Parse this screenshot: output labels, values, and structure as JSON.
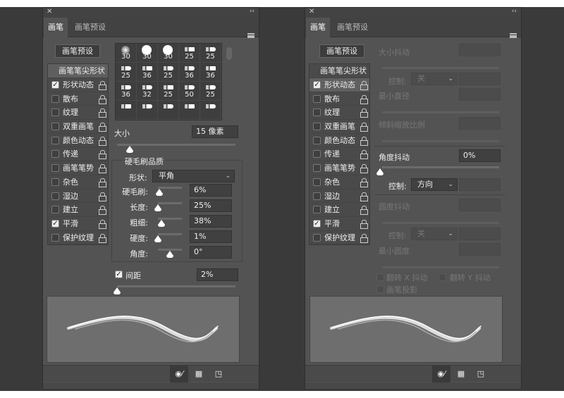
{
  "tabs": [
    "画笔",
    "画笔预设"
  ],
  "preset_button": "画笔预设",
  "list": {
    "header": "画笔笔尖形状",
    "items": [
      {
        "label": "形状动态",
        "checked": true
      },
      {
        "label": "散布",
        "checked": false
      },
      {
        "label": "纹理",
        "checked": false
      },
      {
        "label": "双重画笔",
        "checked": false
      },
      {
        "label": "颜色动态",
        "checked": false
      },
      {
        "label": "传递",
        "checked": false
      },
      {
        "label": "画笔笔势",
        "checked": false
      },
      {
        "label": "杂色",
        "checked": false
      },
      {
        "label": "湿边",
        "checked": false
      },
      {
        "label": "建立",
        "checked": false
      },
      {
        "label": "平滑",
        "checked": true
      },
      {
        "label": "保护纹理",
        "checked": false
      }
    ]
  },
  "brush_grid": {
    "sizes": [
      "30",
      "30",
      "30",
      "25",
      "25",
      "25",
      "36",
      "25",
      "36",
      "36",
      "36",
      "32",
      "25",
      "50",
      "25",
      "",
      "",
      "",
      "",
      ""
    ]
  },
  "left": {
    "size_label": "大小",
    "size_value": "15 像素",
    "size_slider": 0.1,
    "group_title": "硬毛刷品质",
    "shape_label": "形状:",
    "shape_value": "平角",
    "params": [
      {
        "label": "硬毛刷:",
        "value": "6%",
        "pos": 0.06
      },
      {
        "label": "长度:",
        "value": "25%",
        "pos": 0.0
      },
      {
        "label": "粗细:",
        "value": "38%",
        "pos": 0.15
      },
      {
        "label": "硬度:",
        "value": "1%",
        "pos": 0.0
      },
      {
        "label": "角度:",
        "value": "0°",
        "pos": 0.5
      }
    ],
    "spacing_label": "间距",
    "spacing_checked": true,
    "spacing_value": "2%",
    "spacing_slider": 0.0
  },
  "right": {
    "size_jitter": "大小抖动",
    "control1_label": "控制:",
    "control1_value": "关",
    "min_diameter": "最小直径",
    "tilt_scale": "倾斜缩放比例",
    "angle_jitter": "角度抖动",
    "angle_value": "0%",
    "angle_slider": 0.0,
    "control2_label": "控制:",
    "control2_value": "方向",
    "roundness_jitter": "圆度抖动",
    "control3_label": "控制:",
    "control3_value": "关",
    "min_roundness": "最小圆度",
    "flip_x": "翻转 X 抖动",
    "flip_y": "翻转 Y 抖动",
    "brush_projection": "画笔投影"
  },
  "icons": [
    "eye-brush-icon",
    "grid-icon",
    "new-preset-icon"
  ]
}
